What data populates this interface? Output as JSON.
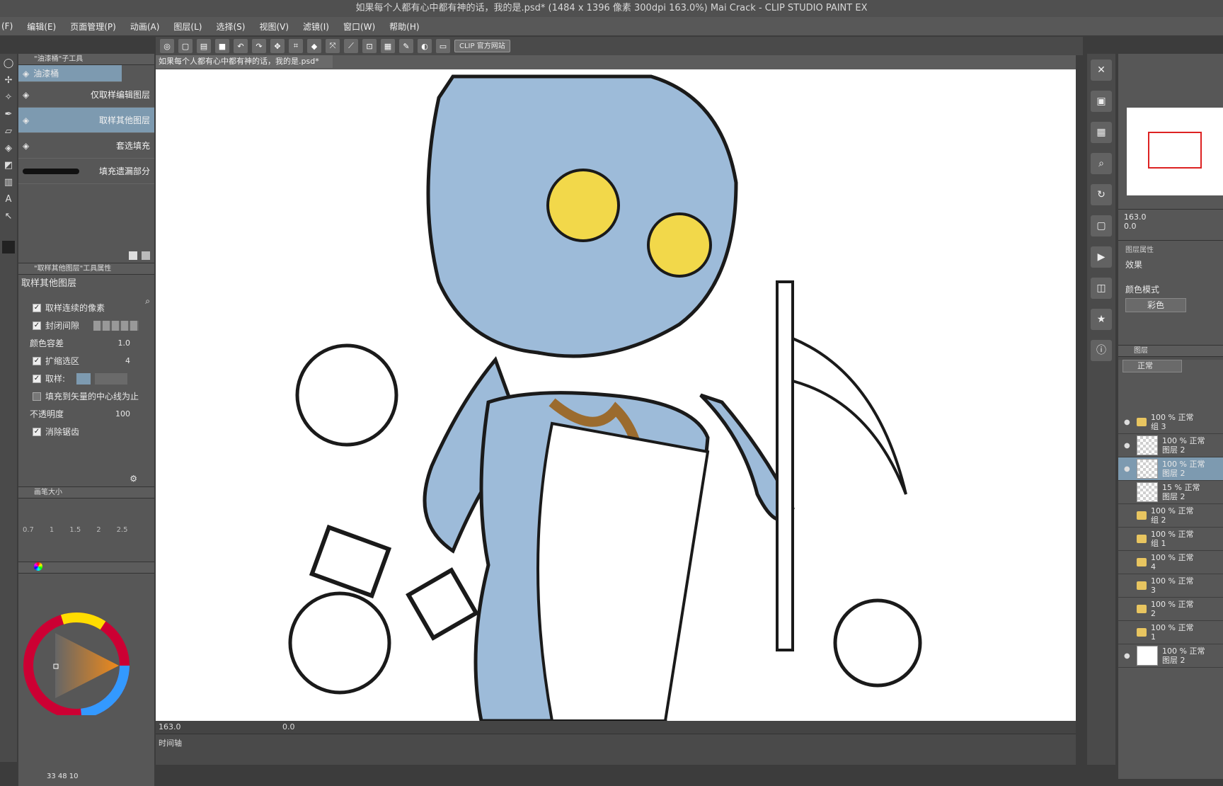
{
  "window": {
    "title": "如果每个人都有心中都有神的话，我的是.psd* (1484 x 1396 像素 300dpi 163.0%)  Mai Crack - CLIP STUDIO PAINT EX"
  },
  "menu": [
    "(F)",
    "编辑(E)",
    "页面管理(P)",
    "动画(A)",
    "图层(L)",
    "选择(S)",
    "视图(V)",
    "滤镜(I)",
    "窗口(W)",
    "帮助(H)"
  ],
  "toolbar": {
    "clip_site_label": "CLIP 官方网站"
  },
  "subtool_panel": {
    "title": "\"油漆桶\"子工具",
    "group_label": "油漆桶",
    "items": [
      "仅取样编辑图层",
      "取样其他图层",
      "套选填充",
      "填充遗漏部分"
    ],
    "selected_index": 1
  },
  "tool_property": {
    "title": "\"取样其他图层\"工具属性",
    "name": "取样其他图层",
    "rows": [
      {
        "label": "取样连续的像素",
        "checked": true
      },
      {
        "label": "封闭间隙",
        "checked": true
      },
      {
        "label": "颜色容差",
        "value": "1.0"
      },
      {
        "label": "扩缩选区",
        "checked": true,
        "value": "4"
      },
      {
        "label": "取样:",
        "checked": true
      },
      {
        "label": "填充到矢量的中心线为止",
        "checked": false
      },
      {
        "label": "不透明度",
        "value": "100"
      },
      {
        "label": "消除锯齿",
        "checked": true
      }
    ]
  },
  "brush_size": {
    "title": "画笔大小",
    "values": [
      "0.7",
      "1",
      "1.5",
      "2",
      "2.5"
    ]
  },
  "color": {
    "footer": "33  48  10"
  },
  "canvas": {
    "tab_label": "如果每个人都有心中都有神的话，我的是.psd*",
    "zoom_label": "163.0",
    "coord_label": "0.0"
  },
  "timeline": {
    "tab_label": "时间轴"
  },
  "navigator": {
    "zoom": "163.0",
    "rotate": "0.0"
  },
  "layer_property": {
    "title": "图层属性",
    "effect_label": "效果",
    "color_mode_label": "颜色模式",
    "color_mode_value": "彩色"
  },
  "layers_panel": {
    "title": "图层",
    "blend_mode": "正常",
    "rows": [
      {
        "name": "100 % 正常",
        "sub": "组 3",
        "type": "folder"
      },
      {
        "name": "100 % 正常",
        "sub": "图层 2",
        "type": "layer"
      },
      {
        "name": "100 % 正常",
        "sub": "图层 2",
        "type": "layer",
        "selected": true
      },
      {
        "name": "15 % 正常",
        "sub": "图层 2",
        "type": "layer"
      },
      {
        "name": "100 % 正常",
        "sub": "组 2",
        "type": "folder"
      },
      {
        "name": "100 % 正常",
        "sub": "组 1",
        "type": "folder"
      },
      {
        "name": "100 % 正常",
        "sub": "4",
        "type": "folder"
      },
      {
        "name": "100 % 正常",
        "sub": "3",
        "type": "folder"
      },
      {
        "name": "100 % 正常",
        "sub": "2",
        "type": "folder"
      },
      {
        "name": "100 % 正常",
        "sub": "1",
        "type": "folder"
      },
      {
        "name": "100 % 正常",
        "sub": "图层 2",
        "type": "paper"
      }
    ]
  },
  "colors": {
    "accent": "#7d9ab0",
    "skin": "#9dbbd9",
    "line": "#1a1a1a",
    "emoji": "#f2d84a"
  }
}
